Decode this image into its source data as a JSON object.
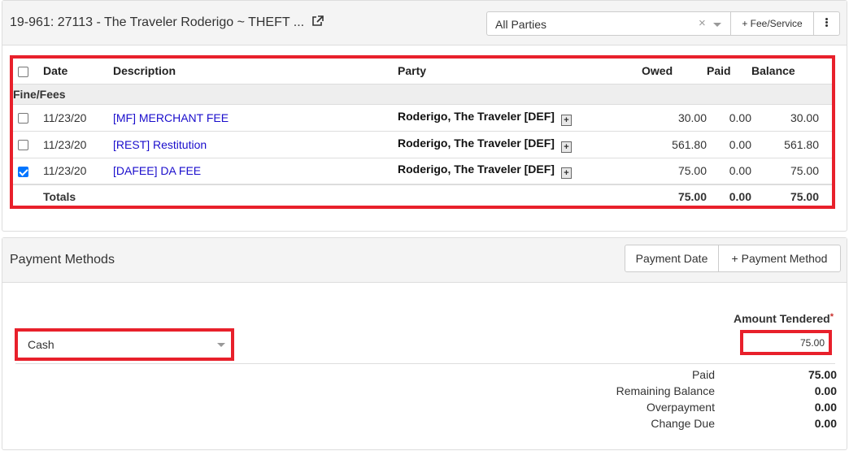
{
  "header": {
    "case_title": "19-961: 27113 - The Traveler Roderigo ~ THEFT ...",
    "external_link_icon": "external-link-icon",
    "party_filter": {
      "value": "All Parties",
      "clear_symbol": "×"
    },
    "fee_service_label": "+ Fee/Service",
    "more_icon": "vertical-ellipsis-icon"
  },
  "fees_table": {
    "columns": [
      "",
      "Date",
      "Description",
      "Party",
      "Owed",
      "Paid",
      "Balance"
    ],
    "group_label": "Fine/Fees",
    "rows": [
      {
        "checked": false,
        "date": "11/23/20",
        "description": "[MF] MERCHANT FEE",
        "party": "Roderigo, The Traveler [DEF]",
        "owed": "30.00",
        "paid": "0.00",
        "balance": "30.00"
      },
      {
        "checked": false,
        "date": "11/23/20",
        "description": "[REST] Restitution",
        "party": "Roderigo, The Traveler [DEF]",
        "owed": "561.80",
        "paid": "0.00",
        "balance": "561.80"
      },
      {
        "checked": true,
        "date": "11/23/20",
        "description": "[DAFEE] DA FEE",
        "party": "Roderigo, The Traveler [DEF]",
        "owed": "75.00",
        "paid": "0.00",
        "balance": "75.00"
      }
    ],
    "totals": {
      "label": "Totals",
      "owed": "75.00",
      "paid": "0.00",
      "balance": "75.00"
    }
  },
  "payment_methods": {
    "title": "Payment Methods",
    "payment_date_label": "Payment Date",
    "add_method_label": "+ Payment Method",
    "method_select": "Cash",
    "amount_tendered_label": "Amount Tendered",
    "required_marker": "*",
    "amount_tendered": "75.00",
    "summary": [
      {
        "label": "Paid",
        "value": "75.00"
      },
      {
        "label": "Remaining Balance",
        "value": "0.00"
      },
      {
        "label": "Overpayment",
        "value": "0.00"
      },
      {
        "label": "Change Due",
        "value": "0.00"
      }
    ]
  },
  "highlight_color": "#e8202b",
  "link_color": "#1a0dcc"
}
